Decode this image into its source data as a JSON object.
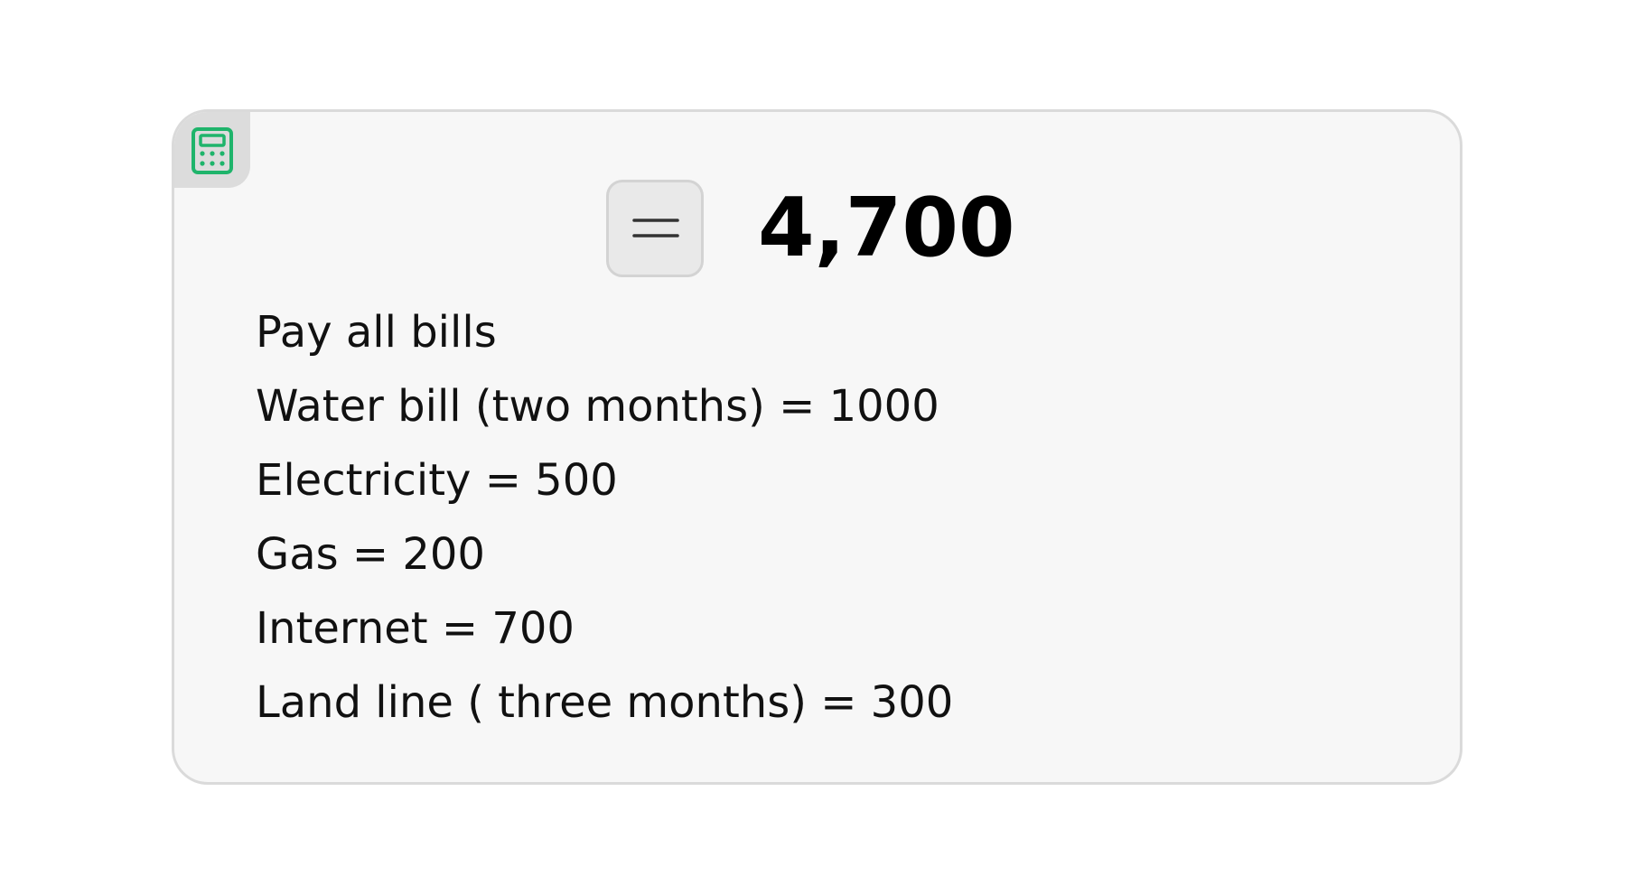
{
  "app": {
    "icon": "calculator-icon",
    "accent_color": "#1fb46b"
  },
  "equals_button": {
    "icon": "equals-icon"
  },
  "result": {
    "value": "4,700"
  },
  "note": {
    "lines": [
      "Pay all bills",
      "Water bill (two months) = 1000",
      "Electricity = 500",
      "Gas = 200",
      "Internet = 700",
      "Land line ( three months) = 300"
    ]
  }
}
